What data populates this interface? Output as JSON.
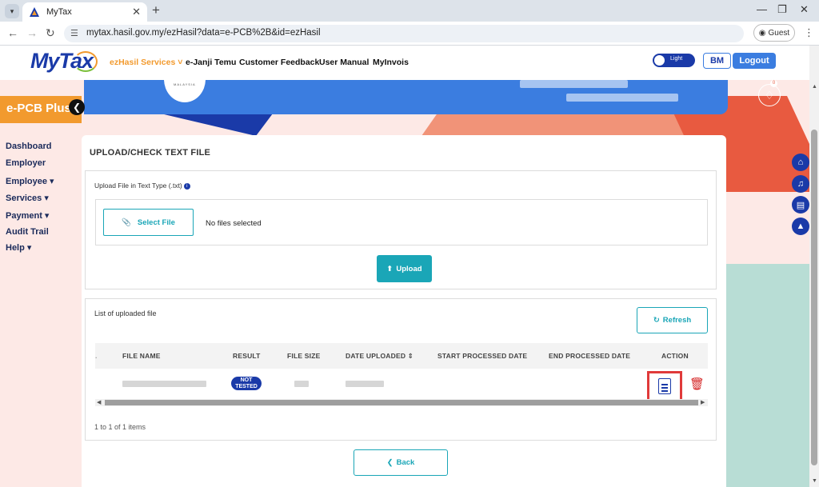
{
  "browser": {
    "tab_title": "MyTax",
    "url": "mytax.hasil.gov.my/ezHasil?data=e-PCB%2B&id=ezHasil",
    "guest_label": "Guest"
  },
  "header": {
    "logo_my": "My",
    "logo_tax": "Tax",
    "menu": [
      "ezHasil Services",
      "e-Janji Temu",
      "Customer Feedback",
      "User Manual",
      "MyInvois"
    ],
    "toggle_label": "Light",
    "user_initials": "BM",
    "logout_label": "Logout",
    "notification_count": "0"
  },
  "sidebar": {
    "title": "e-PCB Plus",
    "items": [
      {
        "label": "Dashboard"
      },
      {
        "label": "Employer"
      },
      {
        "label": "Employee ▾"
      },
      {
        "label": "Services ▾"
      },
      {
        "label": "Payment ▾"
      },
      {
        "label": "Audit Trail"
      },
      {
        "label": "Help ▾"
      }
    ]
  },
  "banner": {
    "seal_text": "MALAYSIA"
  },
  "card": {
    "title": "UPLOAD/CHECK TEXT FILE",
    "upload": {
      "label": "Upload File in Text Type (.txt)",
      "select_file": "Select File",
      "no_files": "No files selected",
      "upload_btn": "Upload"
    },
    "list": {
      "label": "List of uploaded file",
      "refresh": "Refresh",
      "columns": [
        "FILE NAME",
        "RESULT",
        "FILE SIZE",
        "DATE UPLOADED",
        "START PROCESSED DATE",
        "END PROCESSED DATE",
        "ACTION"
      ],
      "rows": [
        {
          "result_line1": "NOT",
          "result_line2": "TESTED"
        }
      ],
      "pager": "1 to 1 of 1 items"
    },
    "back": "Back"
  },
  "colors": {
    "brand_blue": "#1a3aa8",
    "accent_orange": "#f29a2e",
    "teal": "#1aa6b7",
    "highlight_red": "#e03a3a"
  }
}
